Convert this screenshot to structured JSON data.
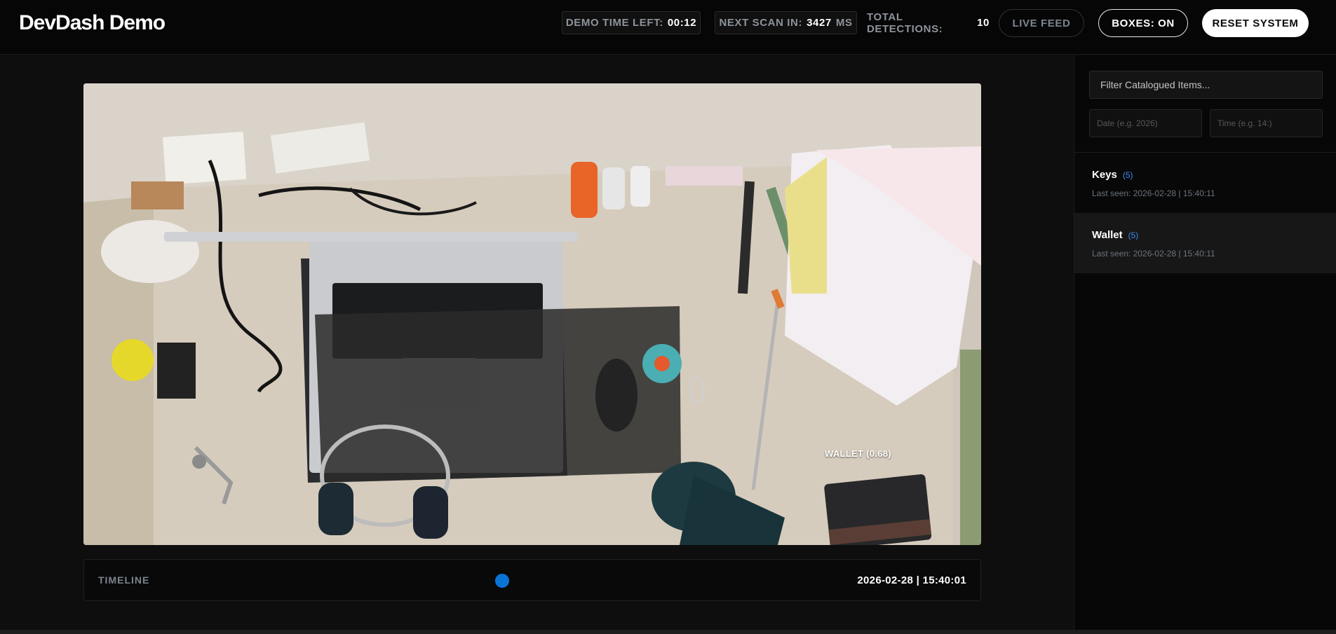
{
  "header": {
    "title": "DevDash Demo",
    "demo_time_label": "DEMO TIME LEFT:",
    "demo_time_value": "00:12",
    "next_scan_label": "NEXT SCAN IN:",
    "next_scan_value": "3427",
    "next_scan_unit": "MS",
    "total_label": "TOTAL DETECTIONS:",
    "total_value": "10",
    "live_feed_label": "LIVE FEED",
    "boxes_label": "BOXES: ON",
    "reset_label": "RESET SYSTEM"
  },
  "feed": {
    "detection_label": "WALLET (0.68)"
  },
  "timeline": {
    "label": "TIMELINE",
    "timestamp": "2026-02-28 | 15:40:01"
  },
  "sidebar": {
    "filter_placeholder": "Filter Catalogued Items...",
    "date_placeholder": "Date (e.g. 2026)",
    "time_placeholder": "Time (e.g. 14:)",
    "items": [
      {
        "name": "Keys",
        "count": "(5)",
        "last_seen": "Last seen: 2026-02-28 | 15:40:11"
      },
      {
        "name": "Wallet",
        "count": "(5)",
        "last_seen": "Last seen: 2026-02-28 | 15:40:11"
      }
    ]
  },
  "colors": {
    "accent": "#0a74d6",
    "count_blue": "#3e8bf2",
    "background": "#0b0b0b"
  }
}
